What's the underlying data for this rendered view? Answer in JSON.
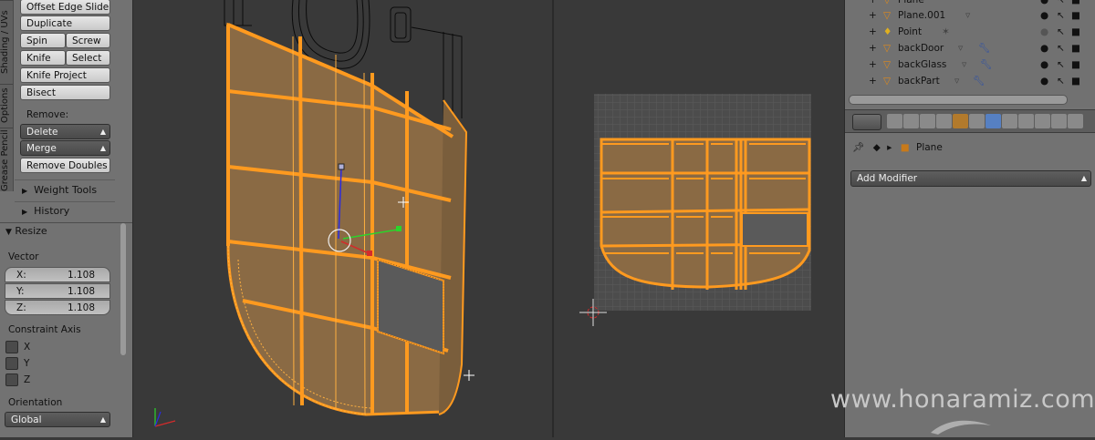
{
  "toolshelf": {
    "tabs": [
      "Shading / UVs",
      "Options",
      "Grease Pencil"
    ],
    "tools": {
      "offset_edge_slide": "Offset Edge Slide",
      "duplicate": "Duplicate",
      "spin": "Spin",
      "screw": "Screw",
      "knife": "Knife",
      "select": "Select",
      "knife_project": "Knife Project",
      "bisect": "Bisect"
    },
    "remove": {
      "label": "Remove:",
      "delete": "Delete",
      "merge": "Merge",
      "remove_doubles": "Remove Doubles"
    },
    "weight_tools": "Weight Tools",
    "history": "History"
  },
  "operator": {
    "title": "Resize",
    "vector_label": "Vector",
    "vector": [
      {
        "axis": "X:",
        "value": "1.108"
      },
      {
        "axis": "Y:",
        "value": "1.108"
      },
      {
        "axis": "Z:",
        "value": "1.108"
      }
    ],
    "constraint_label": "Constraint Axis",
    "constraints": [
      "X",
      "Y",
      "Z"
    ],
    "orientation_label": "Orientation",
    "orientation_value": "Global"
  },
  "outliner": {
    "items": [
      {
        "name": "Plane",
        "type": "mesh"
      },
      {
        "name": "Plane.001",
        "type": "mesh"
      },
      {
        "name": "Point",
        "type": "lamp"
      },
      {
        "name": "backDoor",
        "type": "mesh"
      },
      {
        "name": "backGlass",
        "type": "mesh"
      },
      {
        "name": "backPart",
        "type": "mesh"
      }
    ]
  },
  "properties": {
    "breadcrumb_object": "Plane",
    "add_modifier": "Add Modifier"
  },
  "colors": {
    "select_orange": "#ff9a1f",
    "face_fill": "#8a6a44",
    "panel_bg": "#727272",
    "viewport_bg": "#393939"
  },
  "watermark": "www.honaramiz.com"
}
